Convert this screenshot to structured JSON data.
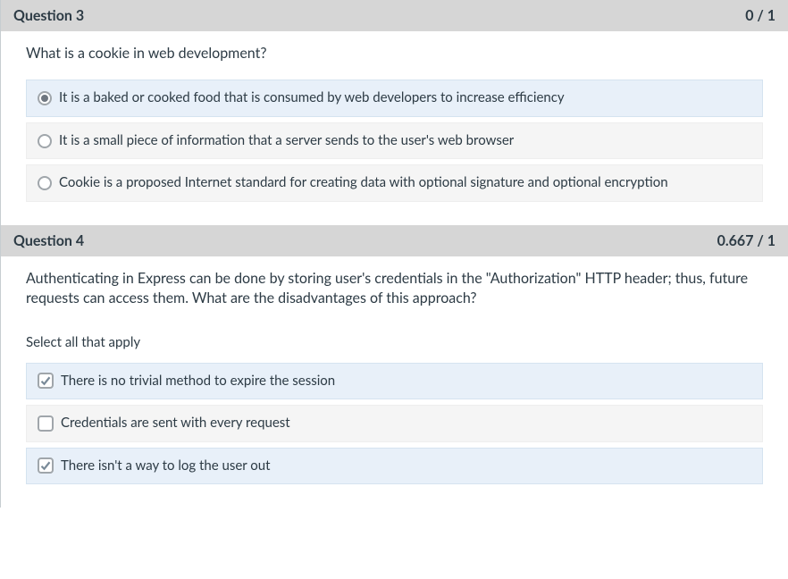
{
  "questions": [
    {
      "label": "Question 3",
      "score": "0 / 1",
      "prompt": "What is a cookie in web development?",
      "type": "radio",
      "instruction": "",
      "options": [
        {
          "text": "It is a baked or cooked food that is consumed by web developers to increase efficiency",
          "selected": true
        },
        {
          "text": "It is a small piece of information that a server sends to the user's web browser",
          "selected": false
        },
        {
          "text": "Cookie is a proposed Internet standard for creating data with optional signature and optional encryption",
          "selected": false
        }
      ]
    },
    {
      "label": "Question 4",
      "score": "0.667 / 1",
      "prompt": "Authenticating in Express can be done by storing user's credentials in the \"Authorization\" HTTP header; thus, future requests can access them. What are the disadvantages of this approach?",
      "type": "checkbox",
      "instruction": "Select all that apply",
      "options": [
        {
          "text": "There is no trivial method to expire the session",
          "selected": true
        },
        {
          "text": "Credentials are sent with every request",
          "selected": false
        },
        {
          "text": "There isn't a way to log the user out",
          "selected": true
        }
      ]
    }
  ]
}
